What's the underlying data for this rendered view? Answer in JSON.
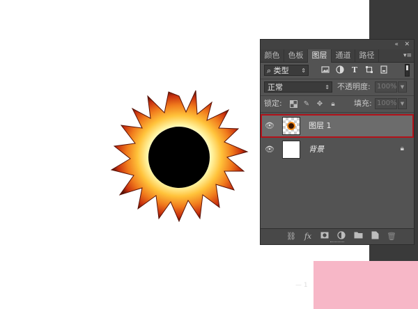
{
  "panel": {
    "collapse_label": "«",
    "close_label": "✕",
    "tabs": [
      {
        "label": "颜色"
      },
      {
        "label": "色板"
      },
      {
        "label": "图层"
      },
      {
        "label": "通道"
      },
      {
        "label": "路径"
      }
    ],
    "active_tab": "图层",
    "menu_label": "▾≡",
    "filter": {
      "search_glyph": "⌕",
      "kind_label": "类型",
      "arrow": "⇕"
    },
    "blend_mode": {
      "value": "正常",
      "arrow": "⇕"
    },
    "opacity": {
      "label": "不透明度:",
      "value": "100%"
    },
    "lock": {
      "label": "锁定:"
    },
    "fill": {
      "label": "填充:",
      "value": "100%"
    },
    "layers": [
      {
        "name": "图层 1",
        "selected": true
      },
      {
        "name": "背景",
        "selected": false
      }
    ]
  },
  "colors": {
    "panel_bg": "#535353",
    "selection_outline": "#b3121a",
    "corner_accent": "#f7b7c7",
    "flame_outer": "#d9421a",
    "flame_inner": "#ffd24a",
    "core": "#000000"
  },
  "watermark_text": "— 1"
}
